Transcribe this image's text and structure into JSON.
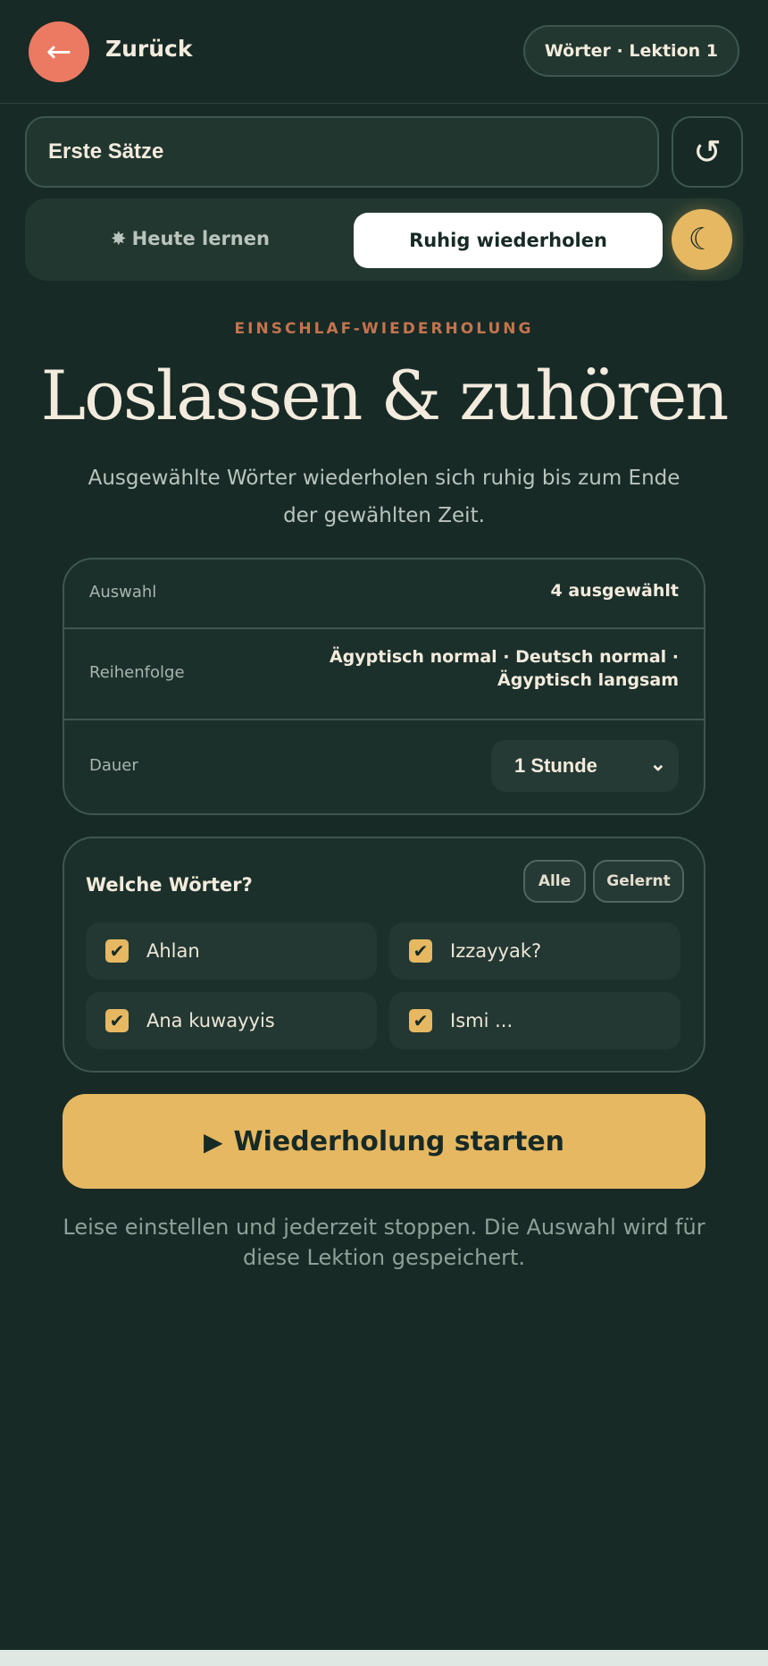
{
  "header": {
    "back_icon": "←",
    "back_label": "Zurück",
    "lesson_label": "Wörter · Lektion 1"
  },
  "deck": {
    "name": "Erste Sätze",
    "refresh_icon": "↺"
  },
  "modes": {
    "today_icon": "✸",
    "today_label": "Heute lernen",
    "calm_label": "Ruhig wiederholen",
    "moon_icon": "☾"
  },
  "hero": {
    "kicker": "EINSCHLAF-WIEDERHOLUNG",
    "title": "Loslassen & zuhören",
    "subtitle": "Ausgewählte Wörter wiederholen sich ruhig bis zum Ende der gewählten Zeit."
  },
  "settings": {
    "selection_label": "Auswahl",
    "selection_value": "4 ausgewählt",
    "order_label": "Reihenfolge",
    "order_value": "Ägyptisch normal · Deutsch normal · Ägyptisch langsam",
    "duration_label": "Dauer",
    "duration_value": "1 Stunde",
    "duration_chevron": "⌄"
  },
  "words": {
    "title": "Welche Wörter?",
    "all_label": "Alle",
    "learned_label": "Gelernt",
    "check_icon": "✔",
    "items": [
      {
        "label": "Ahlan",
        "checked": true
      },
      {
        "label": "Izzayyak?",
        "checked": true
      },
      {
        "label": "Ana kuwayyis",
        "checked": true
      },
      {
        "label": "Ismi ...",
        "checked": true
      }
    ]
  },
  "start": {
    "play_icon": "▶",
    "label": "Wiederholung starten"
  },
  "hint": "Leise einstellen und jederzeit stoppen. Die Auswahl wird für diese Lektion gespeichert.",
  "colors": {
    "background": "#172a26",
    "accent": "#e6b862",
    "back": "#ec7a62",
    "kicker": "#c4744e"
  }
}
